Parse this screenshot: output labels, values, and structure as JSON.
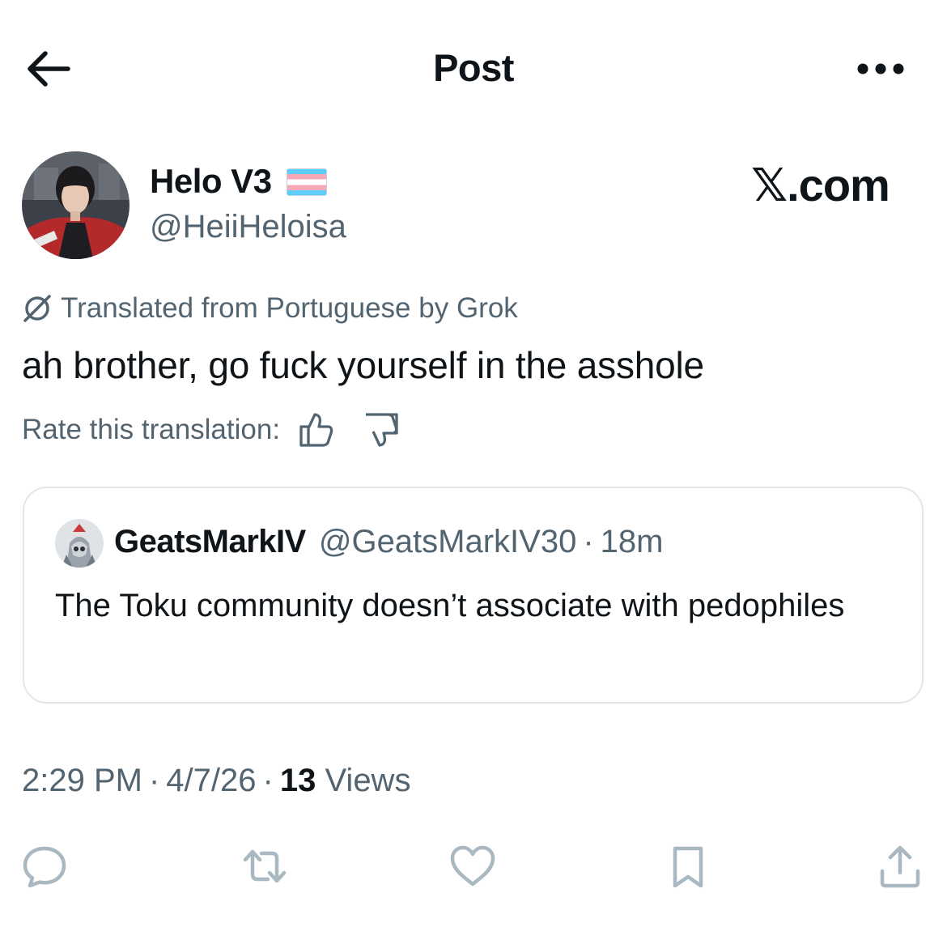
{
  "header": {
    "title": "Post",
    "back_icon": "arrow-left-icon",
    "more_icon": "more-horizontal-icon"
  },
  "author": {
    "name": "Helo V3",
    "handle": "@HeiiHeloisa",
    "flag_icon": "transgender-flag-icon"
  },
  "watermark": {
    "x": "𝕏",
    "suffix": ".com"
  },
  "translation": {
    "icon": "grok-icon",
    "label": "Translated from Portuguese by Grok",
    "rate_label": "Rate this translation:",
    "thumbs_up_icon": "thumbs-up-icon",
    "thumbs_down_icon": "thumbs-down-icon"
  },
  "tweet": {
    "text": "ah brother, go fuck yourself in the asshole"
  },
  "quote": {
    "name": "GeatsMarkIV",
    "handle": "@GeatsMarkIV30",
    "dot": "·",
    "time": "18m",
    "text": "The Toku community doesn’t associate with pedophiles"
  },
  "meta": {
    "time": "2:29 PM",
    "sep": "·",
    "date": "4/7/26",
    "views_count": "13",
    "views_label": "Views"
  },
  "actions": {
    "reply_icon": "reply-icon",
    "repost_icon": "repost-icon",
    "like_icon": "heart-icon",
    "bookmark_icon": "bookmark-icon",
    "share_icon": "share-icon"
  },
  "colors": {
    "text": "#0f1419",
    "secondary": "#536471",
    "action_icon": "#aab8c2",
    "border": "#e3e7ea",
    "flag_blue": "#5bcefa",
    "flag_pink": "#f5a9b8"
  }
}
